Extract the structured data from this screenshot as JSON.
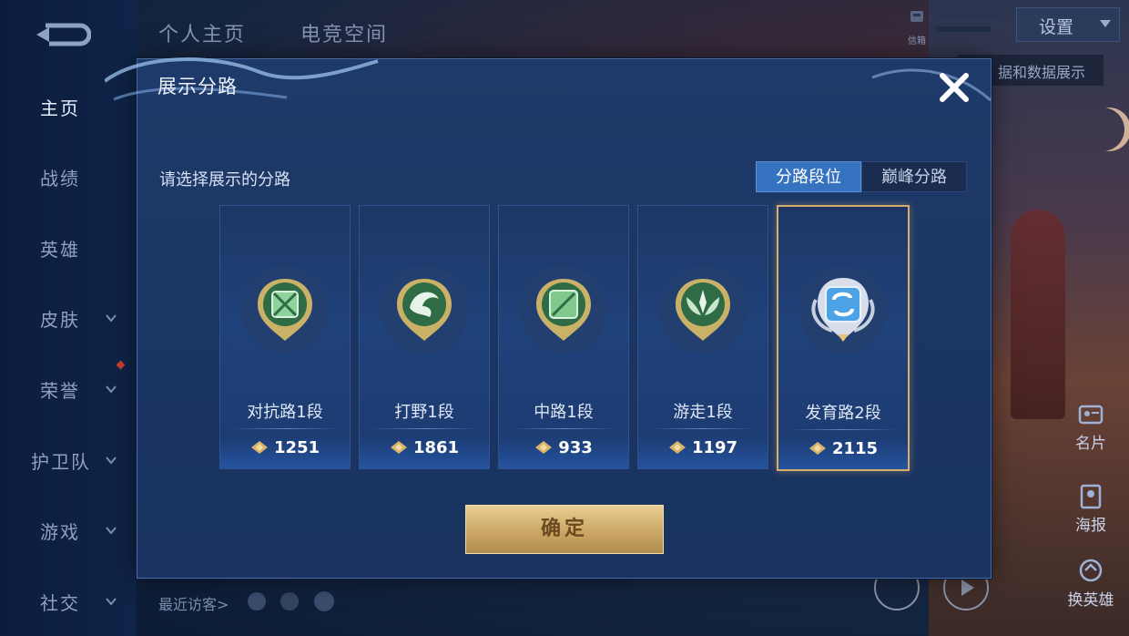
{
  "sidebar": {
    "items": [
      {
        "label": "主页",
        "active": true,
        "has_chevron": false
      },
      {
        "label": "战绩",
        "active": false,
        "has_chevron": false
      },
      {
        "label": "英雄",
        "active": false,
        "has_chevron": false
      },
      {
        "label": "皮肤",
        "active": false,
        "has_chevron": true
      },
      {
        "label": "荣誉",
        "active": false,
        "has_chevron": true
      },
      {
        "label": "护卫队",
        "active": false,
        "has_chevron": true
      },
      {
        "label": "游戏",
        "active": false,
        "has_chevron": true
      },
      {
        "label": "社交",
        "active": false,
        "has_chevron": true
      }
    ]
  },
  "top_tabs": [
    {
      "label": "个人主页"
    },
    {
      "label": "电竞空间"
    }
  ],
  "header": {
    "settings_label": "设置",
    "mailbox_label": "信箱",
    "sub_tip_label": "据和数据展示"
  },
  "right_utils": [
    {
      "label": "名片",
      "icon": "card-icon"
    },
    {
      "label": "海报",
      "icon": "poster-icon"
    },
    {
      "label": "换英雄",
      "icon": "swap-hero-icon"
    }
  ],
  "recent_visitors_label": "最近访客>",
  "modal": {
    "title": "展示分路",
    "prompt": "请选择展示的分路",
    "segments": [
      {
        "label": "分路段位",
        "active": true
      },
      {
        "label": "巅峰分路",
        "active": false
      }
    ],
    "cards": [
      {
        "rank": "对抗路1段",
        "score": "1251",
        "icon": "clash-lane-emblem-icon",
        "selected": false
      },
      {
        "rank": "打野1段",
        "score": "1861",
        "icon": "jungle-emblem-icon",
        "selected": false
      },
      {
        "rank": "中路1段",
        "score": "933",
        "icon": "mid-lane-emblem-icon",
        "selected": false
      },
      {
        "rank": "游走1段",
        "score": "1197",
        "icon": "roam-emblem-icon",
        "selected": false
      },
      {
        "rank": "发育路2段",
        "score": "2115",
        "icon": "farm-lane-emblem-icon",
        "selected": true
      }
    ],
    "confirm_label": "确定"
  },
  "colors": {
    "accent_blue": "#3572c0",
    "gold": "#d7ad6c",
    "panel": "#1e3a6a"
  }
}
